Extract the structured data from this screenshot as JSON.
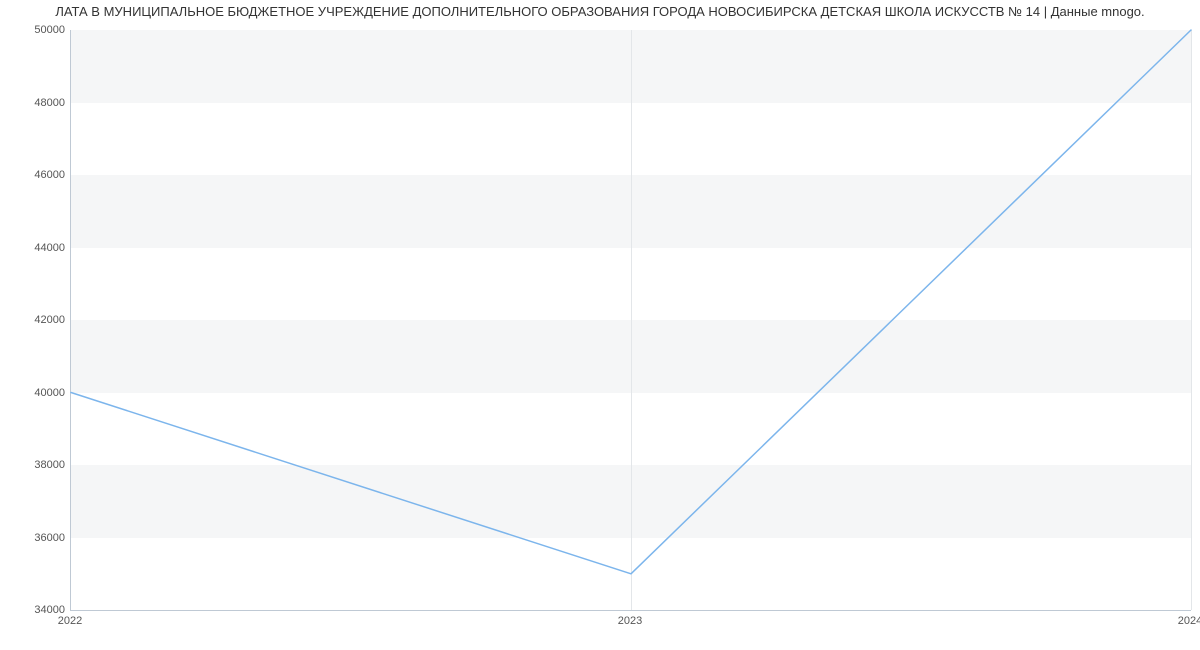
{
  "chart_data": {
    "type": "line",
    "title": "ЛАТА В МУНИЦИПАЛЬНОЕ БЮДЖЕТНОЕ УЧРЕЖДЕНИЕ ДОПОЛНИТЕЛЬНОГО ОБРАЗОВАНИЯ ГОРОДА НОВОСИБИРСКА ДЕТСКАЯ ШКОЛА ИСКУССТВ № 14 | Данные mnogo.",
    "categories": [
      "2022",
      "2023",
      "2024"
    ],
    "x": [
      2022,
      2023,
      2024
    ],
    "values": [
      40000,
      35000,
      50000
    ],
    "xlabel": "",
    "ylabel": "",
    "ylim": [
      34000,
      50000
    ],
    "y_ticks": [
      34000,
      36000,
      38000,
      40000,
      42000,
      44000,
      46000,
      48000,
      50000
    ],
    "x_ticks": [
      2022,
      2023,
      2024
    ],
    "band_color": "#f5f6f7",
    "line_color": "#7cb5ec"
  }
}
